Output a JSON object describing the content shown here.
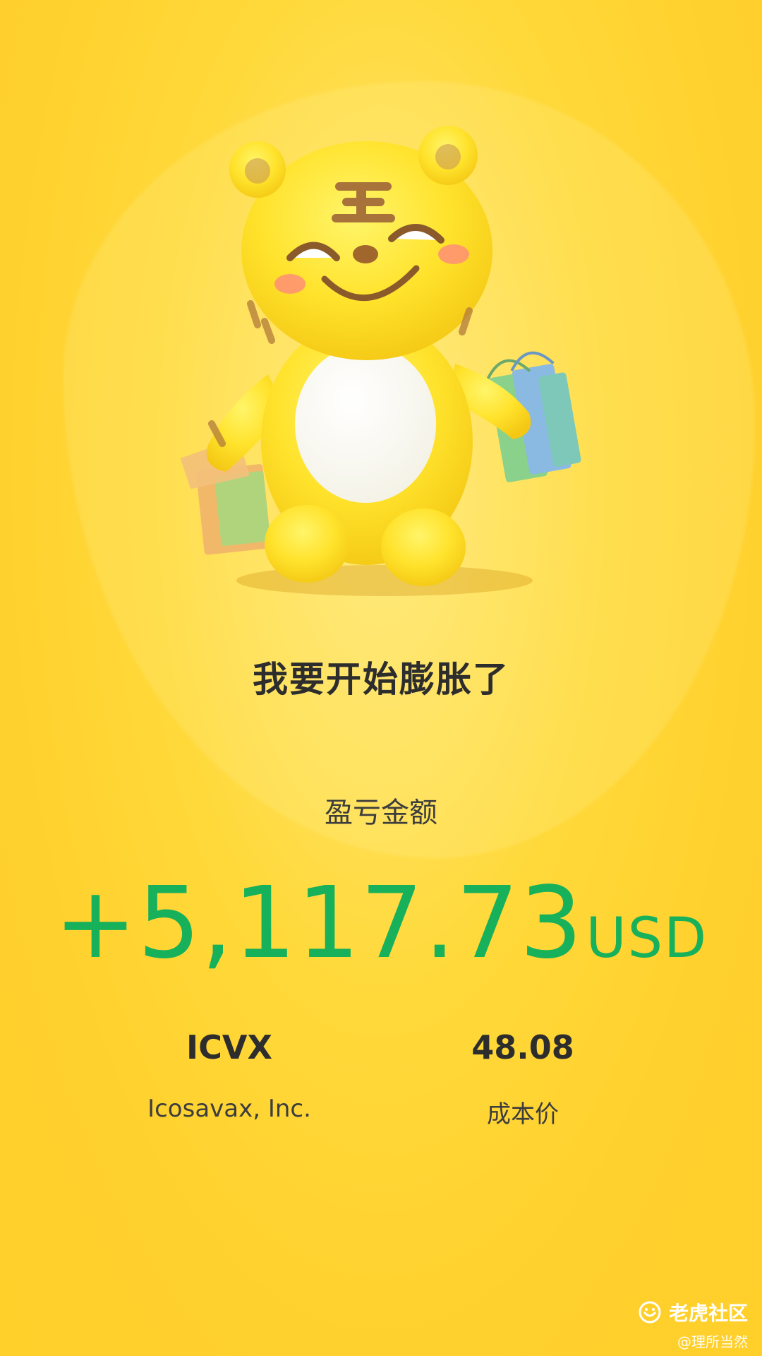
{
  "headline": "我要开始膨胀了",
  "pnl": {
    "label": "盈亏金额",
    "value": "+5,117.73",
    "currency": "USD",
    "color": "#17b05b"
  },
  "stock": {
    "symbol": "ICVX",
    "name": "Icosavax, Inc."
  },
  "cost": {
    "value": "48.08",
    "label": "成本价"
  },
  "watermark": {
    "brand": "老虎社区",
    "user": "@理所当然",
    "icon": "tiger-logo-icon"
  },
  "mascot_icon": "tiger-mascot-with-shopping-bags"
}
